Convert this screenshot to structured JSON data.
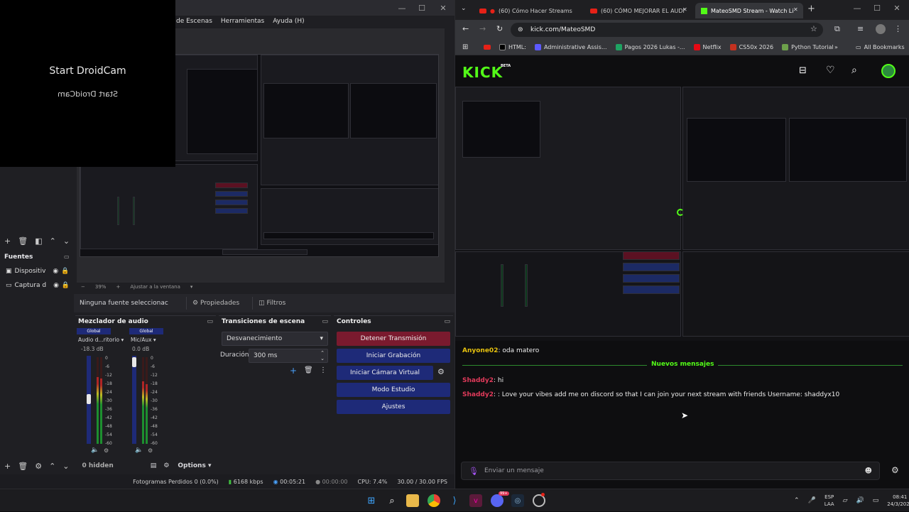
{
  "obs": {
    "menu": [
      "de Escenas",
      "Herramientas",
      "Ayuda (H)"
    ],
    "droidcam_title": "Start DroidCam",
    "droidcam_mirror": "Start DroidCam",
    "zoom": "39%",
    "zoom_mode": "Ajustar a la ventana",
    "fuentes_title": "Fuentes",
    "sources": [
      {
        "label": "Dispositiv"
      },
      {
        "label": "Captura d"
      }
    ],
    "no_source": "Ninguna fuente seleccionac",
    "properties_label": "Propiedades",
    "filters_label": "Filtros",
    "mixer": {
      "title": "Mezclador de audio",
      "ch1": {
        "tag": "Global",
        "name": "Audio d...ritorio",
        "db": "-18.3 dB"
      },
      "ch2": {
        "tag": "Global",
        "name": "Mic/Aux",
        "db": "0.0 dB"
      },
      "scale": [
        "0",
        "-6",
        "-12",
        "-18",
        "-24",
        "-30",
        "-36",
        "-42",
        "-48",
        "-54",
        "-60"
      ],
      "hidden": "0 hidden",
      "options": "Options"
    },
    "transitions": {
      "title": "Transiciones de escena",
      "type": "Desvanecimiento",
      "duration_label": "Duración",
      "duration_value": "300 ms"
    },
    "controls": {
      "title": "Controles",
      "stop_stream": "Detener Transmisión",
      "start_record": "Iniciar Grabación",
      "virtual_cam": "Iniciar Cámara Virtual",
      "studio_mode": "Modo Estudio",
      "settings": "Ajustes"
    },
    "status": {
      "dropped": "Fotogramas Perdidos 0 (0.0%)",
      "bitrate": "6168 kbps",
      "stream_time": "00:05:21",
      "record_time": "00:00:00",
      "cpu": "CPU: 7.4%",
      "fps": "30.00 / 30.00 FPS"
    }
  },
  "chrome": {
    "tabs": [
      {
        "label": "(60) Cómo Hacer Streams"
      },
      {
        "label": "(60) CÓMO MEJORAR EL AUDI"
      },
      {
        "label": "MateoSMD Stream - Watch Li"
      }
    ],
    "url": "kick.com/MateoSMD",
    "bookmarks": [
      {
        "label": "HTML:",
        "color": "#000000"
      },
      {
        "label": "Administrative Assis...",
        "color": "#5c59ff"
      },
      {
        "label": "Pagos 2026 Lukas -...",
        "color": "#1ea362"
      },
      {
        "label": "Netflix",
        "color": "#e50914"
      },
      {
        "label": "CS50x 2026",
        "color": "#c4311f"
      },
      {
        "label": "Python Tutorial",
        "color": "#6da04b"
      }
    ],
    "all_bookmarks": "All Bookmarks"
  },
  "kick": {
    "logo": "KICK",
    "beta": "BETA",
    "chat": [
      {
        "user": "Anyone02",
        "user_color": "#e6c10e",
        "text": ": oda matero"
      },
      {
        "user": "Shaddy2",
        "user_color": "#e03a5a",
        "text": ": hi"
      },
      {
        "user": "Shaddy2",
        "user_color": "#e03a5a",
        "text": ": : Love your vibes add me on discord so that I can join your next stream with friends Username: shaddyx10"
      }
    ],
    "new_messages": "Nuevos mensajes",
    "input_placeholder": "Enviar un mensaje"
  },
  "taskbar": {
    "lang": "ESP",
    "layout": "LAA",
    "time": "08:41",
    "date": "24/3/2026",
    "discord_badge": "99+"
  }
}
